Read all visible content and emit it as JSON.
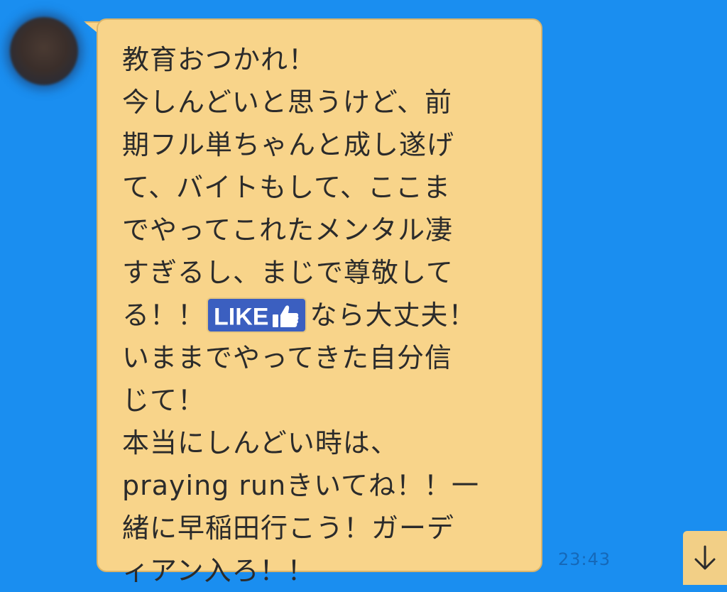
{
  "message": {
    "lines_before_like": [
      "教育おつかれ！",
      "今しんどいと思うけど、前",
      "期フル単ちゃんと成し遂げ",
      "て、バイトもして、ここま",
      "でやってこれたメンタル凄",
      "すぎるし、まじで尊敬して"
    ],
    "like_line_prefix": "る！！",
    "like_badge_text": "LIKE",
    "like_badge_icon": "thumbs-up-icon",
    "like_line_suffix": "なら大丈夫！",
    "lines_after_like": [
      "いままでやってきた自分信",
      "じて！",
      "本当にしんどい時は、",
      "praying runきいてね！！一",
      "緒に早稲田行こう！ガーデ",
      "ィアン入ろ！！"
    ]
  },
  "timestamp": "23:43",
  "scroll_down_icon": "arrow-down-icon",
  "colors": {
    "background": "#1a8ef0",
    "bubble": "#f8d48a",
    "like_badge": "#3b5fc0"
  }
}
